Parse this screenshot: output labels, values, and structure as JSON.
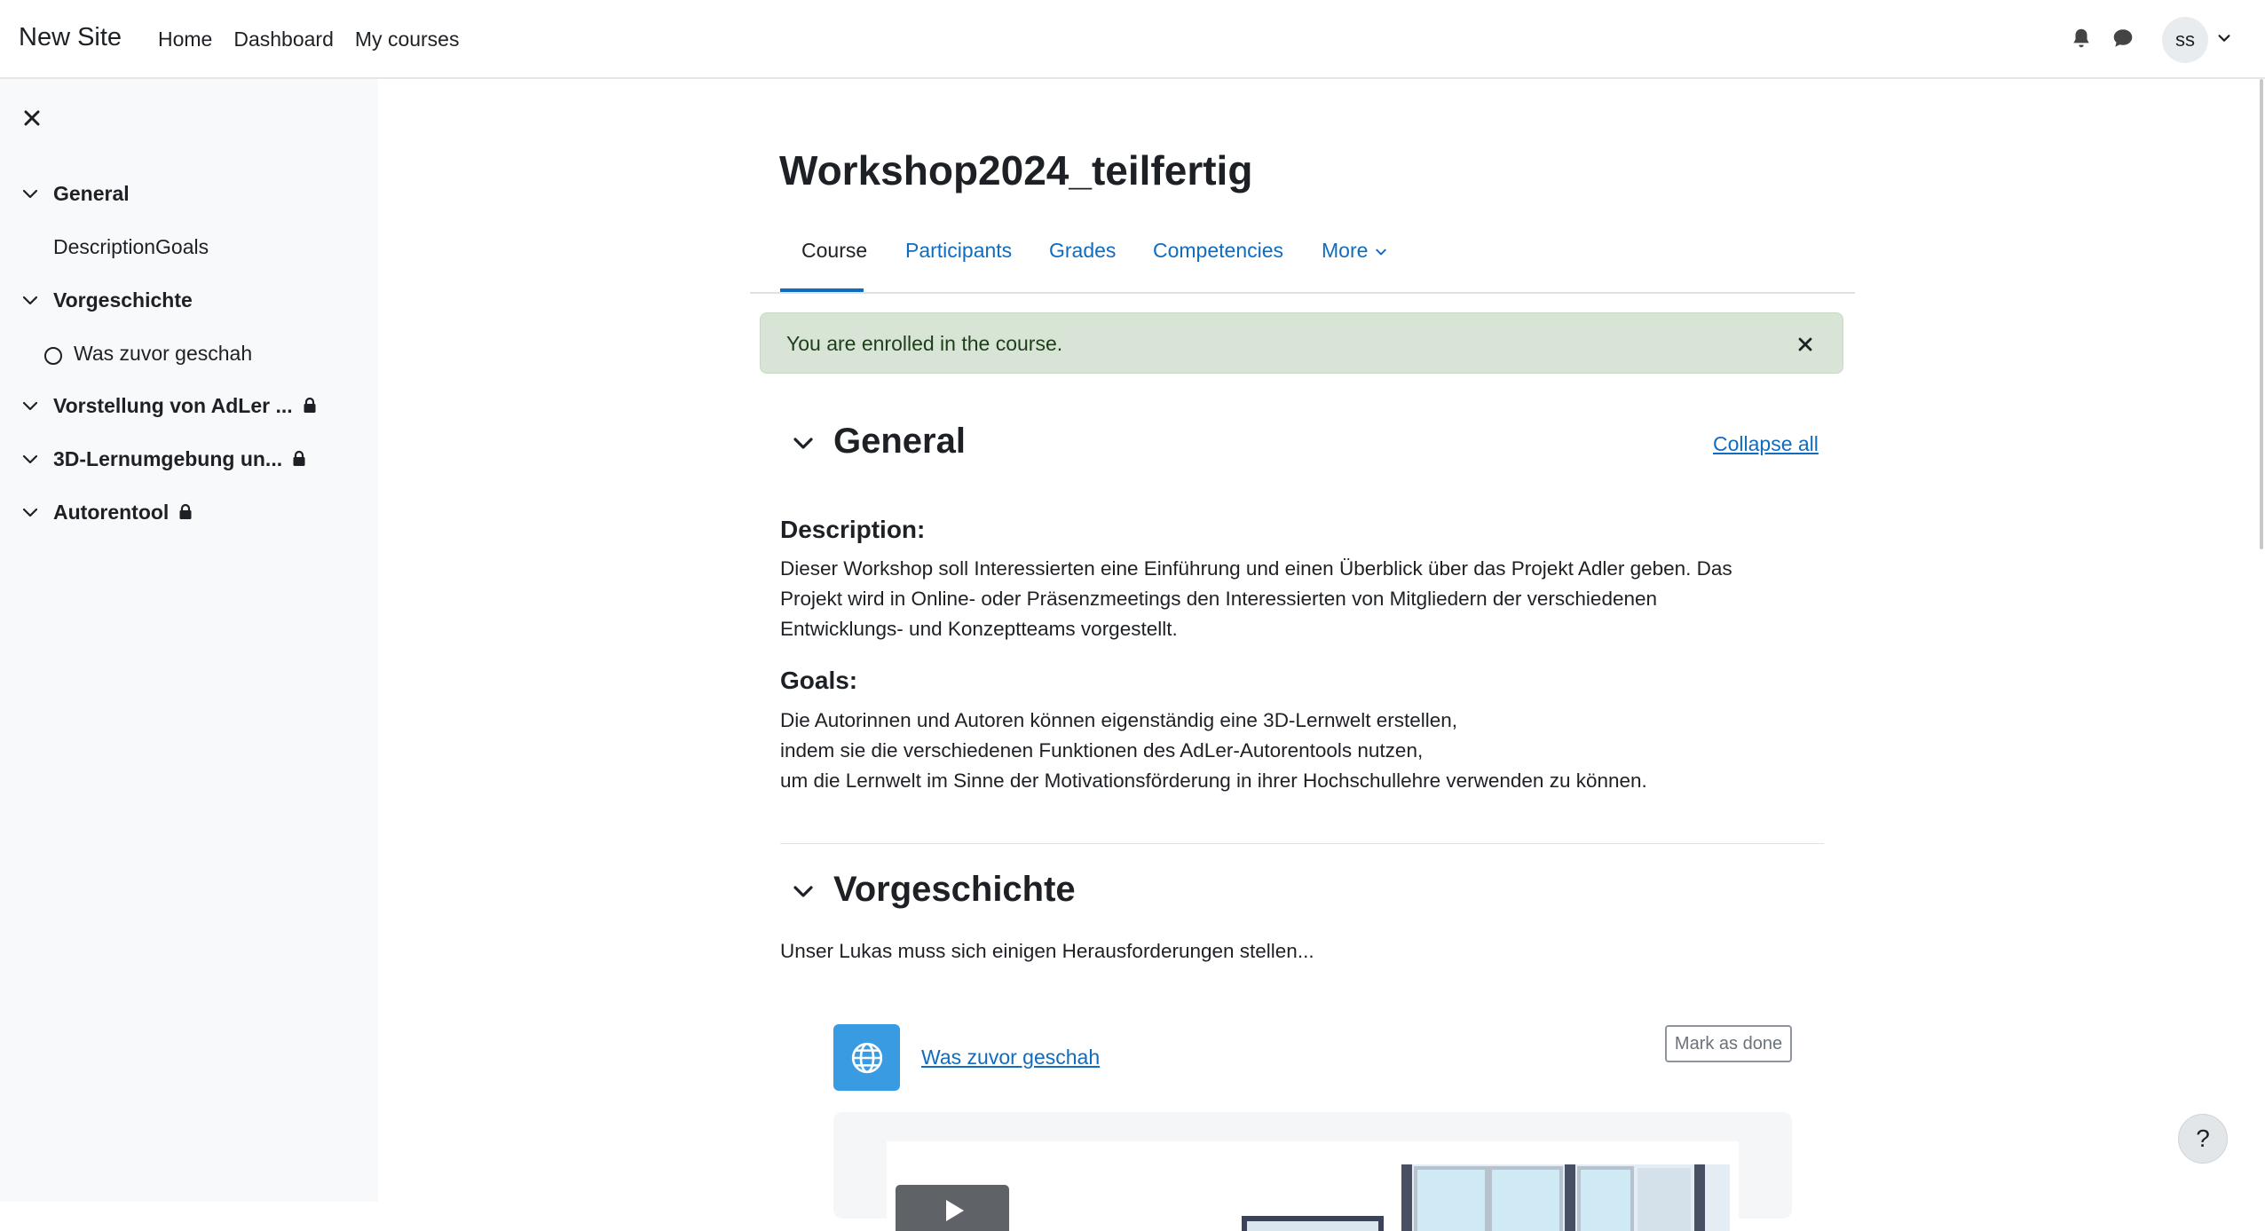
{
  "navbar": {
    "brand": "New Site",
    "links": [
      "Home",
      "Dashboard",
      "My courses"
    ],
    "user_initials": "ss"
  },
  "course_index": {
    "sections": [
      {
        "title": "General",
        "items": [
          {
            "label": "DescriptionGoals"
          }
        ]
      },
      {
        "title": "Vorgeschichte",
        "items": [
          {
            "label": "Was zuvor geschah"
          }
        ]
      },
      {
        "title": "Vorstellung von AdLer ...",
        "locked": true
      },
      {
        "title": "3D-Lernumgebung un...",
        "locked": true
      },
      {
        "title": "Autorentool",
        "locked": true
      }
    ]
  },
  "page": {
    "title": "Workshop2024_teilfertig",
    "tabs": [
      "Course",
      "Participants",
      "Grades",
      "Competencies",
      "More"
    ],
    "active_tab": "Course"
  },
  "alert": {
    "text": "You are enrolled in the course."
  },
  "general_section": {
    "title": "General",
    "collapse_all": "Collapse all",
    "description_label": "Description:",
    "description_lines": [
      "Dieser Workshop soll Interessierten eine Einführung und einen Überblick über das Projekt Adler geben. Das",
      "Projekt wird in Online- oder Präsenzmeetings den Interessierten von Mitgliedern der verschiedenen",
      "Entwicklungs- und Konzeptteams vorgestellt."
    ],
    "goals_label": "Goals:",
    "goals_lines": [
      "Die Autorinnen und Autoren können eigenständig eine 3D-Lernwelt erstellen,",
      "indem sie die verschiedenen Funktionen des AdLer-Autorentools nutzen,",
      "um die Lernwelt im Sinne der Motivationsförderung in ihrer Hochschullehre verwenden zu können."
    ]
  },
  "vorgeschichte_section": {
    "title": "Vorgeschichte",
    "summary": "Unser Lukas muss sich einigen Herausforderungen stellen...",
    "activity": {
      "name": "Was zuvor geschah",
      "icon": "globe-icon",
      "completion_button": "Mark as done"
    }
  },
  "help_button": "?",
  "colors": {
    "link": "#0f6cbf",
    "drawer_bg": "#f8f9fa",
    "alert_bg": "#d7e4d6",
    "activity_icon_bg": "#399be2"
  }
}
